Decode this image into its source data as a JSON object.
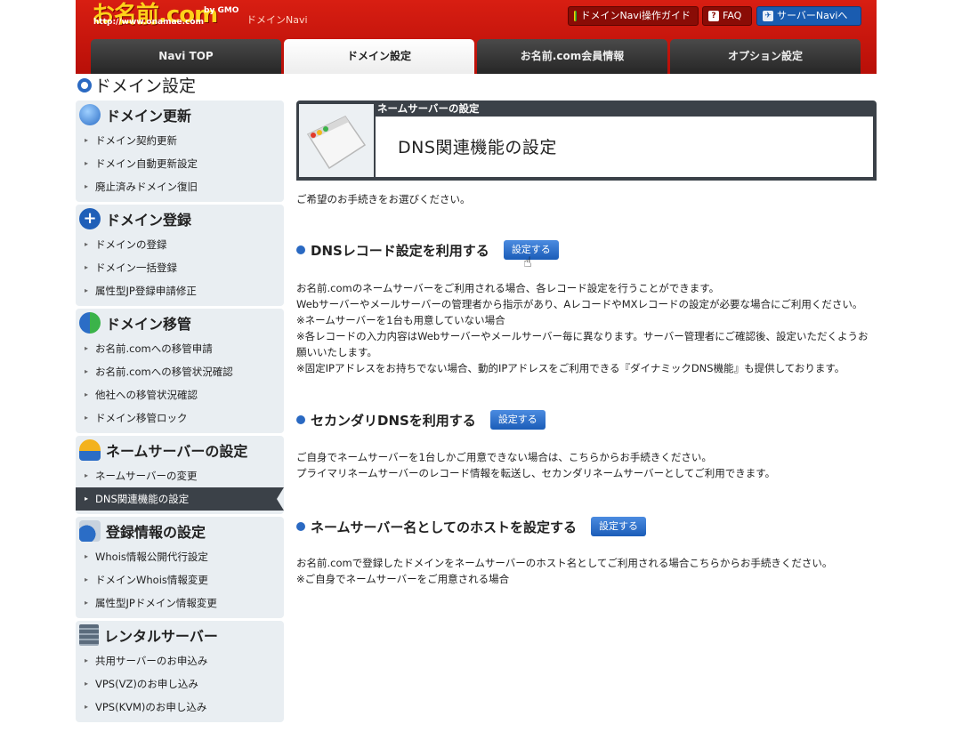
{
  "header": {
    "logo_text": "お名前.com",
    "logo_url_text": "http://www.onamae.com",
    "gmo_text": "by GMO",
    "navi_name": "ドメインNavi",
    "guide_button": "ドメインNavi操作ガイド",
    "faq_button": "FAQ",
    "server_button": "サーバーNaviへ"
  },
  "tabs": [
    {
      "label": "Navi TOP"
    },
    {
      "label": "ドメイン設定"
    },
    {
      "label": "お名前.com会員情報"
    },
    {
      "label": "オプション設定"
    }
  ],
  "page_title": "ドメイン設定",
  "sidebar": [
    {
      "title": "ドメイン更新",
      "items": [
        "ドメイン契約更新",
        "ドメイン自動更新設定",
        "廃止済みドメイン復旧"
      ]
    },
    {
      "title": "ドメイン登録",
      "items": [
        "ドメインの登録",
        "ドメイン一括登録",
        "属性型JP登録申請修正"
      ]
    },
    {
      "title": "ドメイン移管",
      "items": [
        "お名前.comへの移管申請",
        "お名前.comへの移管状況確認",
        "他社への移管状況確認",
        "ドメイン移管ロック"
      ]
    },
    {
      "title": "ネームサーバーの設定",
      "items": [
        "ネームサーバーの変更",
        "DNS関連機能の設定"
      ]
    },
    {
      "title": "登録情報の設定",
      "items": [
        "Whois情報公開代行設定",
        "ドメインWhois情報変更",
        "属性型JPドメイン情報変更"
      ]
    },
    {
      "title": "レンタルサーバー",
      "items": [
        "共用サーバーのお申込み",
        "VPS(VZ)のお申し込み",
        "VPS(KVM)のお申し込み"
      ]
    }
  ],
  "main": {
    "box_caption": "ネームサーバーの設定",
    "box_title": "DNS関連機能の設定",
    "intro": "ご希望のお手続きをお選びください。",
    "options": [
      {
        "title": "DNSレコード設定を利用する",
        "button": "設定する",
        "desc": [
          "お名前.comのネームサーバーをご利用される場合、各レコード設定を行うことができます。",
          "Webサーバーやメールサーバーの管理者から指示があり、AレコードやMXレコードの設定が必要な場合にご利用ください。",
          "※ネームサーバーを1台も用意していない場合",
          "※各レコードの入力内容はWebサーバーやメールサーバー毎に異なります。サーバー管理者にご確認後、設定いただくようお願いいたします。",
          "※固定IPアドレスをお持ちでない場合、動的IPアドレスをご利用できる『ダイナミックDNS機能』も提供しております。"
        ]
      },
      {
        "title": "セカンダリDNSを利用する",
        "button": "設定する",
        "desc": [
          "ご自身でネームサーバーを1台しかご用意できない場合は、こちらからお手続きください。",
          "プライマリネームサーバーのレコード情報を転送し、セカンダリネームサーバーとしてご利用できます。"
        ]
      },
      {
        "title": "ネームサーバー名としてのホストを設定する",
        "button": "設定する",
        "desc": [
          "お名前.comで登録したドメインをネームサーバーのホスト名としてご利用される場合こちらからお手続きください。",
          "※ご自身でネームサーバーをご用意される場合"
        ]
      }
    ]
  },
  "colors": {
    "header_red": "#c8150c",
    "accent_blue": "#2a69c2",
    "dark_panel": "#3b4148",
    "sidebar_bg": "#e9eef2"
  }
}
